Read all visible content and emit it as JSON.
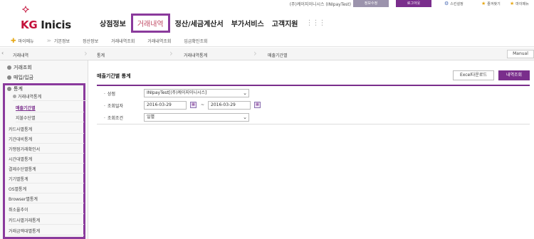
{
  "topbar": {
    "store_label": "(주)케이지이니시스 (INIpayTest)",
    "info_button": "정보수정",
    "logout_button": "로그아웃",
    "links": [
      {
        "icon": "gear-icon",
        "label": "스킨설정"
      },
      {
        "icon": "star-icon",
        "label": "즐겨찾기"
      },
      {
        "icon": "star-icon",
        "label": "마이메뉴"
      }
    ]
  },
  "logo": {
    "mark": "⯎",
    "text_kg": "KG",
    "text_rest": " Inicis"
  },
  "gnb": {
    "items": [
      "상점정보",
      "거래내역",
      "정산/세금계산서",
      "부가서비스",
      "고객지원"
    ],
    "active": "거래내역"
  },
  "subnav": {
    "my_menu": "마이메뉴",
    "items": [
      "기본정보",
      "정산정보",
      "거래내역조회",
      "거래내역조회",
      "입금확인조회"
    ]
  },
  "breadcrumb": {
    "section": "거래내역",
    "items": [
      "통계",
      "거래내역통계",
      "매출기간별"
    ],
    "manual": "Manual"
  },
  "sidebar": {
    "groups": [
      "거래조회",
      "매입/입금",
      "통계"
    ],
    "stats_group": "거래내역통계",
    "stats_sub": [
      "매출기간별",
      "지불수단별"
    ],
    "active": "매출기간별",
    "items": [
      "카드사별통계",
      "기간대비통계",
      "가맹점거래확인서",
      "시간대별통계",
      "결제수단별통계",
      "기기별통계",
      "OS별통계",
      "Browser별통계",
      "취소율추이",
      "카드사별거래통계",
      "거래금액대별통계"
    ]
  },
  "content": {
    "title": "매출기간별 통계",
    "excel_button": "Excel다운로드",
    "search_button": "내역조회",
    "form": {
      "store_label": "상점",
      "store_value": "INIpayTest[(주)케이지이니시스]",
      "date_label": "조회일자",
      "date_from": "2016-03-29",
      "date_to": "2016-03-29",
      "tilde": "~",
      "cond_label": "조회조건",
      "cond_value": "일별"
    }
  },
  "colors": {
    "brand": "#c4113a",
    "accent": "#7a2e8c",
    "highlight": "#8a3a9c"
  }
}
